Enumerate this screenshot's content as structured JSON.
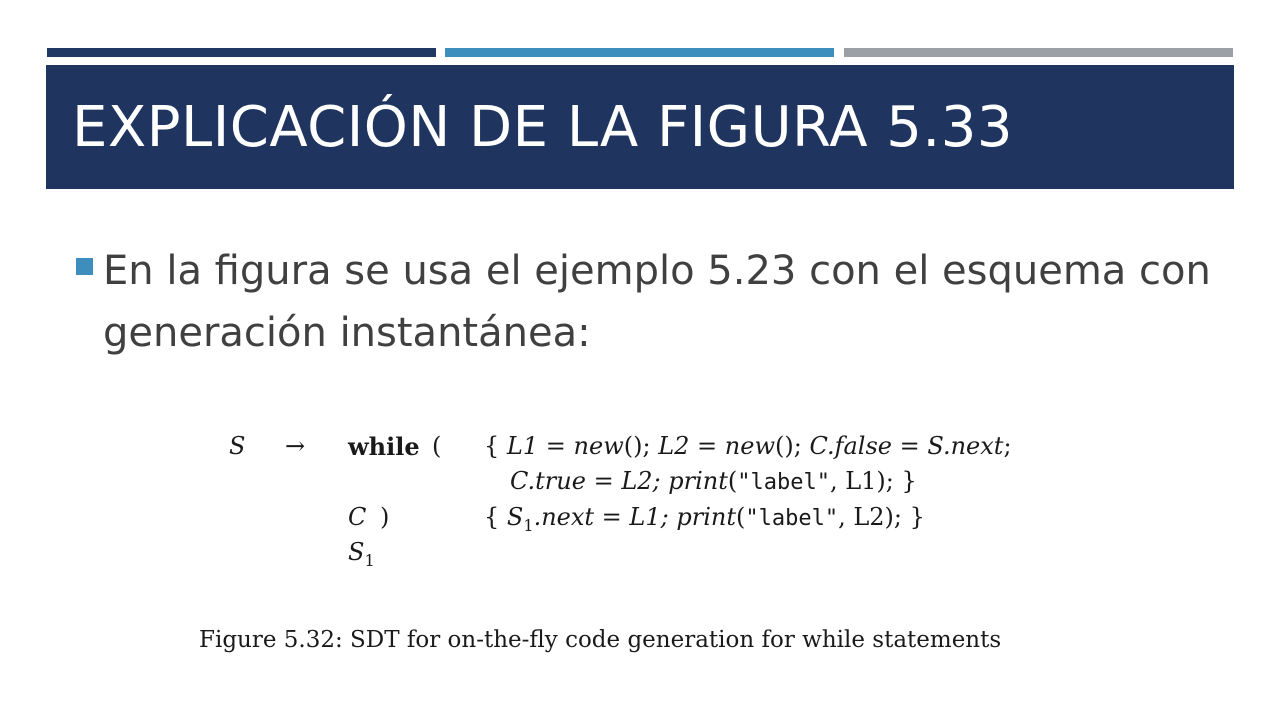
{
  "colors": {
    "dark_navy": "#1f3864",
    "steel_blue": "#3e8ebd",
    "gray": "#9aa0a6",
    "title_band": "#1f3560",
    "bullet": "#3e8ebd",
    "text": "#404040"
  },
  "slide": {
    "title": "EXPLICACIÓN DE LA FIGURA 5.33",
    "bullet": "En la figura se usa el ejemplo 5.23 con el esquema con generación instantánea:"
  },
  "figure": {
    "row1": {
      "lhs": "S",
      "arrow": "→",
      "keyword": "while",
      "paren": "(",
      "brace": "{",
      "L1": "L1",
      "eq": "=",
      "new1": "new",
      "after_new1": "();",
      "L2": "L2",
      "new2": "new",
      "after_new2": "();",
      "C": "C",
      "false_attr": ".false",
      "S": "S",
      "next_attr": ".next",
      "end": ";"
    },
    "row2": {
      "C": "C",
      "true_attr": ".true",
      "eq": "=",
      "L2": "L2;",
      "print": "print",
      "open": "(",
      "label": "\"label\"",
      "arg": ", L1); }"
    },
    "row3": {
      "C": "C",
      "paren": ")",
      "brace": "{",
      "S": "S",
      "sub": "1",
      "next_attr": ".next",
      "eq": "=",
      "L1": "L1;",
      "print": "print",
      "open": "(",
      "label": "\"label\"",
      "arg": ", L2); }"
    },
    "row4": {
      "S": "S",
      "sub": "1"
    },
    "caption": "Figure 5.32: SDT for on-the-fly code generation for while statements"
  }
}
